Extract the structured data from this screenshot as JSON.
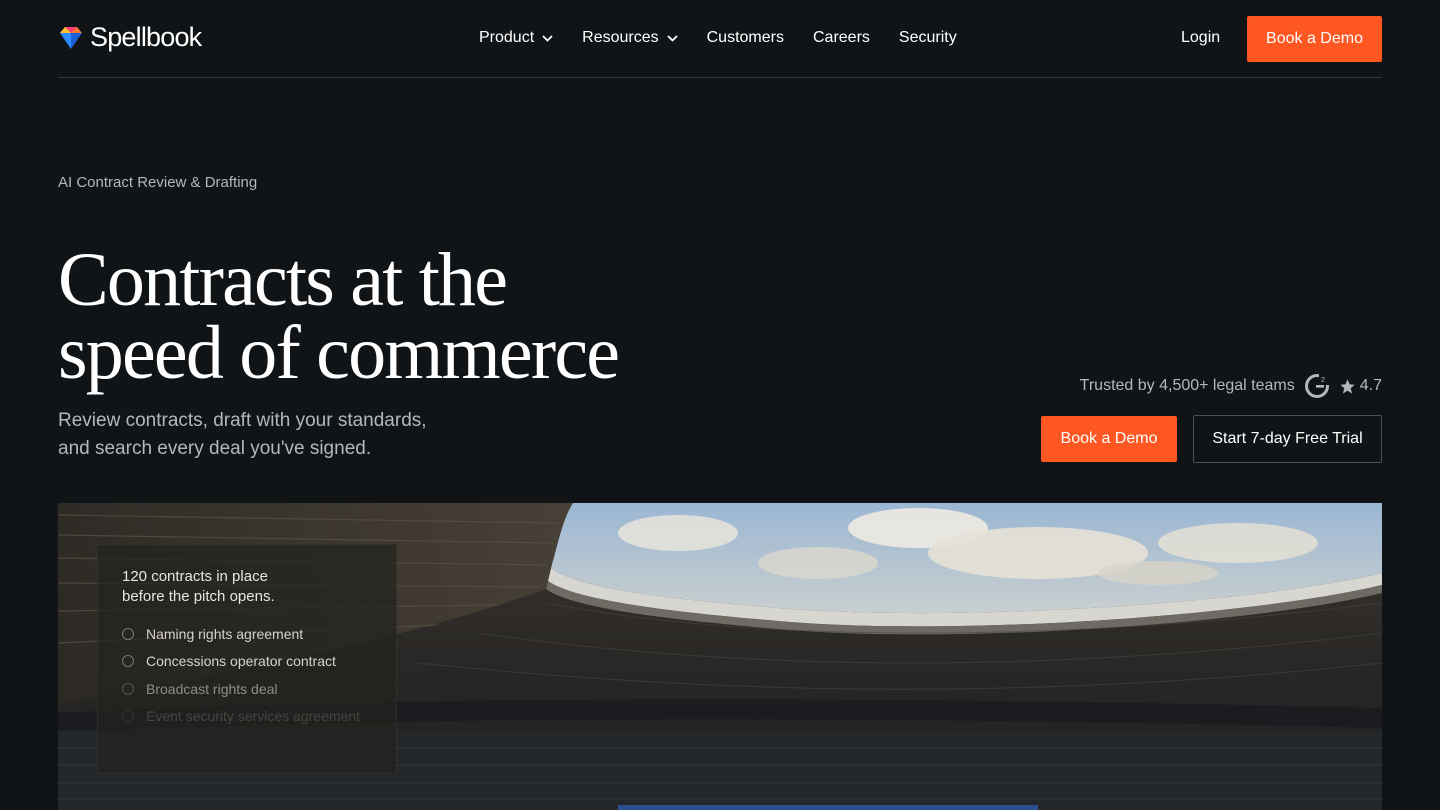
{
  "header": {
    "brand": "Spellbook",
    "nav": [
      {
        "label": "Product",
        "dropdown": true
      },
      {
        "label": "Resources",
        "dropdown": true
      },
      {
        "label": "Customers",
        "dropdown": false
      },
      {
        "label": "Careers",
        "dropdown": false
      },
      {
        "label": "Security",
        "dropdown": false
      }
    ],
    "login_label": "Login",
    "demo_label": "Book a Demo"
  },
  "hero": {
    "eyebrow": "AI Contract Review & Drafting",
    "headline_line1": "Contracts at the",
    "headline_line2": "speed of commerce",
    "sub_line1": "Review contracts, draft with your standards,",
    "sub_line2": "and search every deal you've signed.",
    "trust_text": "Trusted by 4,500+ legal teams",
    "rating": "4.7",
    "cta_demo": "Book a Demo",
    "cta_trial": "Start 7-day Free Trial"
  },
  "card": {
    "title_line1": "120 contracts in place",
    "title_line2": "before the pitch opens.",
    "items": [
      "Naming rights agreement",
      "Concessions operator contract",
      "Broadcast rights deal",
      "Event security services agreement"
    ]
  },
  "colors": {
    "background": "#101417",
    "accent": "#ff5722",
    "muted_text": "#b3b8bd"
  },
  "icons": {
    "logo": "diamond-gem-icon",
    "dropdown": "chevron-down-icon",
    "g2": "g2-logo-icon",
    "rating": "star-icon"
  }
}
